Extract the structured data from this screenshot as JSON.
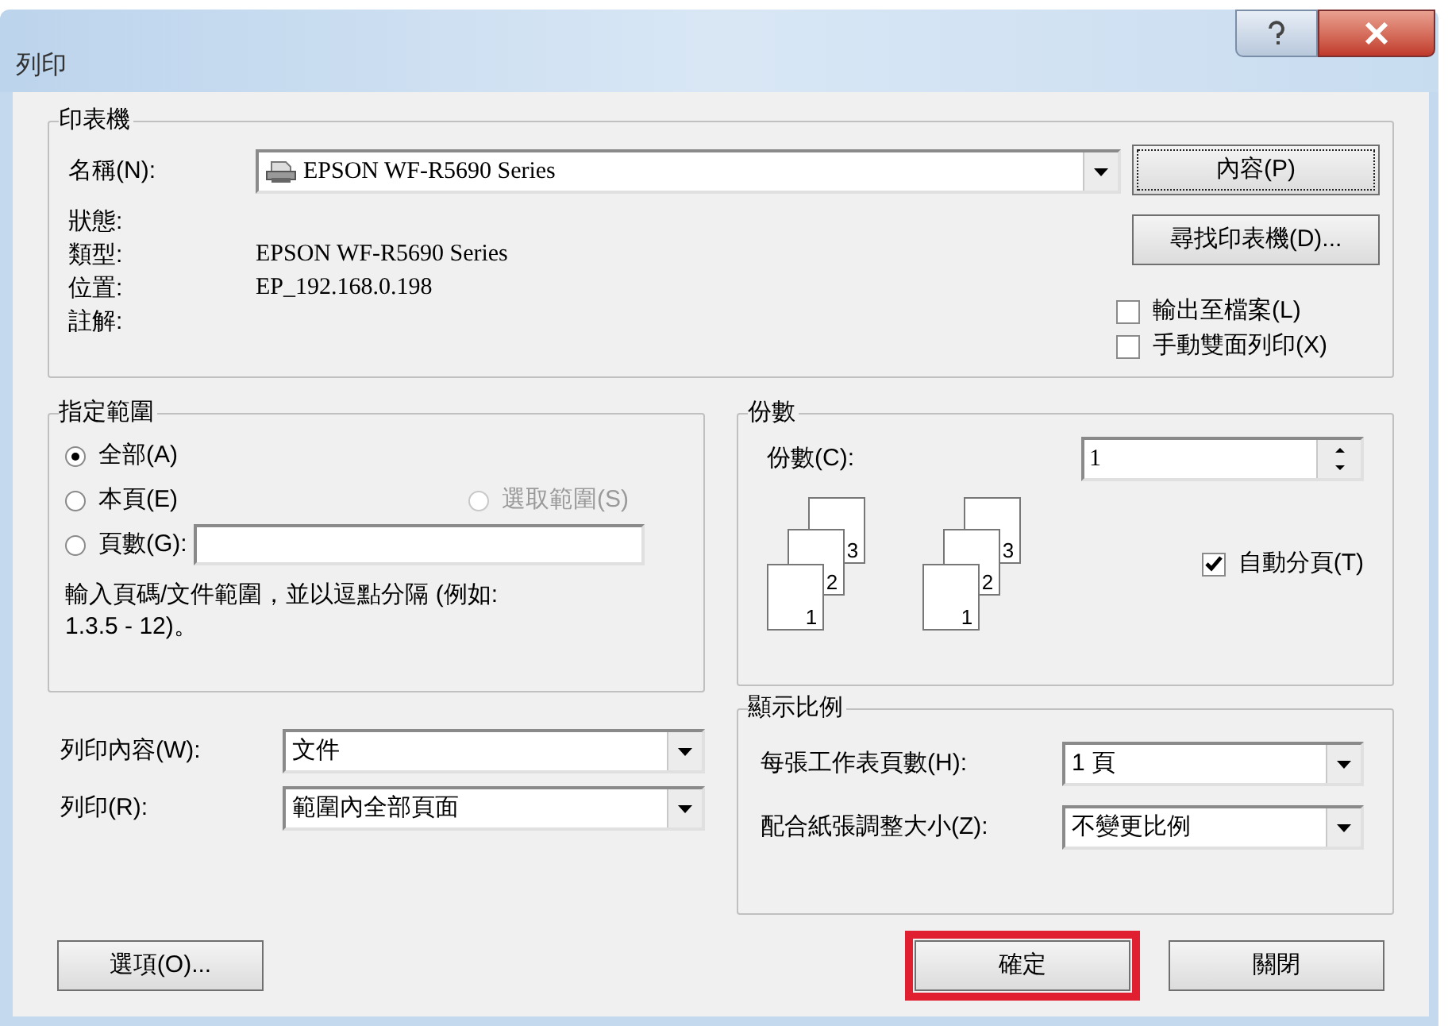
{
  "window": {
    "title": "列印"
  },
  "printer": {
    "legend": "印表機",
    "name_label": "名稱(N):",
    "name_value": "EPSON WF-R5690 Series",
    "properties_button": "內容(P)",
    "find_button": "尋找印表機(D)...",
    "info": [
      {
        "label": "狀態:"
      },
      {
        "label": "類型:",
        "value": "EPSON WF-R5690 Series"
      },
      {
        "label": "位置:",
        "value": "EP_192.168.0.198"
      },
      {
        "label": "註解:"
      }
    ],
    "options": [
      {
        "label": "輸出至檔案(L)",
        "checked": false
      },
      {
        "label": "手動雙面列印(X)",
        "checked": false
      }
    ]
  },
  "range": {
    "legend": "指定範圍",
    "options": [
      {
        "label": "全部(A)",
        "selected": true,
        "disabled": false
      },
      {
        "label": "本頁(E)",
        "selected": false,
        "disabled": false
      },
      {
        "label": "選取範圍(S)",
        "selected": false,
        "disabled": true
      },
      {
        "label": "頁數(G):",
        "selected": false,
        "disabled": false
      }
    ],
    "hint": "輸入頁碼/文件範圍，並以逗點分隔 (例如: 1.3.5 - 12)。"
  },
  "copies": {
    "legend": "份數",
    "label": "份數(C):",
    "value": "1",
    "page_stacks": [
      [
        "1",
        "2",
        "3"
      ],
      [
        "1",
        "2",
        "3"
      ]
    ],
    "collate": {
      "label": "自動分頁(T)",
      "checked": true
    }
  },
  "print_what": [
    {
      "label": "列印內容(W):",
      "value": "文件"
    },
    {
      "label": "列印(R):",
      "value": "範圍內全部頁面"
    }
  ],
  "zoom": {
    "legend": "顯示比例",
    "fields": [
      {
        "label": "每張工作表頁數(H):",
        "value": "1 頁"
      },
      {
        "label": "配合紙張調整大小(Z):",
        "value": "不變更比例"
      }
    ]
  },
  "buttons": [
    {
      "label": "選項(O)...",
      "highlighted": false
    },
    {
      "label": "確定",
      "highlighted": true
    },
    {
      "label": "關閉",
      "highlighted": false
    }
  ]
}
